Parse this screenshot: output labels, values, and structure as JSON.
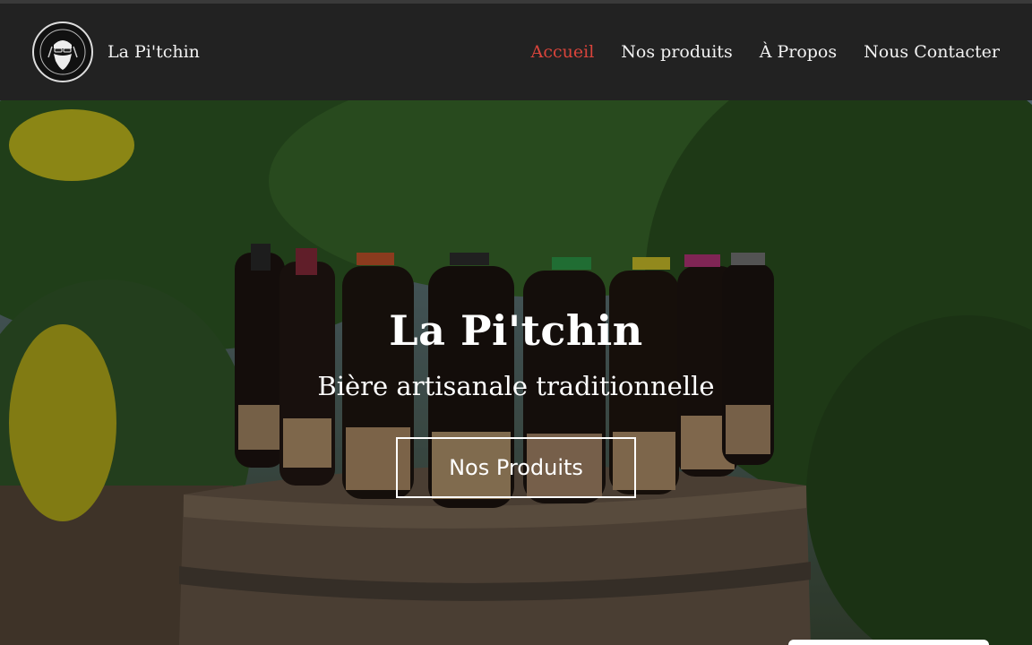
{
  "brand": {
    "name": "La Pi'tchin",
    "logo_icon": "bearded-man-hops-logo"
  },
  "nav": {
    "items": [
      {
        "label": "Accueil",
        "active": true
      },
      {
        "label": "Nos produits",
        "active": false
      },
      {
        "label": "À Propos",
        "active": false
      },
      {
        "label": "Nous Contacter",
        "active": false
      }
    ]
  },
  "hero": {
    "title": "La Pi'tchin",
    "subtitle": "Bière artisanale traditionnelle",
    "cta_label": "Nos Produits",
    "background_image": "beer-bottles-on-barrel-photo"
  },
  "colors": {
    "header_bg": "#222222",
    "active_link": "#d9443b",
    "text": "#f2f2f2"
  }
}
